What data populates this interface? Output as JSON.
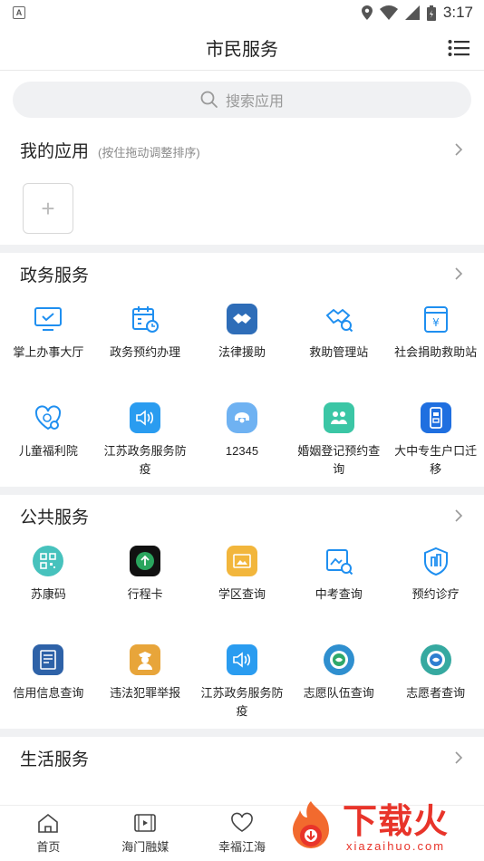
{
  "status": {
    "badge": "A",
    "time": "3:17"
  },
  "appbar": {
    "title": "市民服务"
  },
  "search": {
    "placeholder": "搜索应用"
  },
  "my_apps": {
    "title": "我的应用",
    "hint": "(按住拖动调整排序)",
    "add_label": "+"
  },
  "gov": {
    "title": "政务服务",
    "items": [
      {
        "label": "掌上办事大厅",
        "icon": "monitor-check-icon"
      },
      {
        "label": "政务预约办理",
        "icon": "calendar-clock-icon"
      },
      {
        "label": "法律援助",
        "icon": "handshake-icon"
      },
      {
        "label": "救助管理站",
        "icon": "handshake-search-icon"
      },
      {
        "label": "社会捐助救助站",
        "icon": "yen-box-icon"
      },
      {
        "label": "儿童福利院",
        "icon": "child-heart-icon"
      },
      {
        "label": "江苏政务服务防疫",
        "icon": "speaker-icon"
      },
      {
        "label": "12345",
        "icon": "hotline-icon"
      },
      {
        "label": "婚姻登记预约查询",
        "icon": "couple-icon"
      },
      {
        "label": "大中专生户口迁移",
        "icon": "phone-doc-icon"
      }
    ]
  },
  "public": {
    "title": "公共服务",
    "items": [
      {
        "label": "苏康码",
        "icon": "health-code-icon"
      },
      {
        "label": "行程卡",
        "icon": "trip-card-icon"
      },
      {
        "label": "学区查询",
        "icon": "school-district-icon"
      },
      {
        "label": "中考查询",
        "icon": "exam-search-icon"
      },
      {
        "label": "预约诊疗",
        "icon": "hospital-icon"
      },
      {
        "label": "信用信息查询",
        "icon": "credit-doc-icon"
      },
      {
        "label": "违法犯罪举报",
        "icon": "police-icon"
      },
      {
        "label": "江苏政务服务防疫",
        "icon": "speaker-icon"
      },
      {
        "label": "志愿队伍查询",
        "icon": "volunteer-team-icon"
      },
      {
        "label": "志愿者查询",
        "icon": "volunteer-icon"
      }
    ]
  },
  "life": {
    "title": "生活服务"
  },
  "nav": [
    {
      "label": "首页",
      "icon": "home-icon"
    },
    {
      "label": "海门融媒",
      "icon": "video-icon"
    },
    {
      "label": "幸福江海",
      "icon": "heart-icon"
    }
  ],
  "watermark": {
    "cn": "下载火",
    "en": "xiazaihuo.com"
  },
  "colors": {
    "primary": "#1f8ff0",
    "accent_red": "#e8342a",
    "divider": "#f0f1f3"
  }
}
